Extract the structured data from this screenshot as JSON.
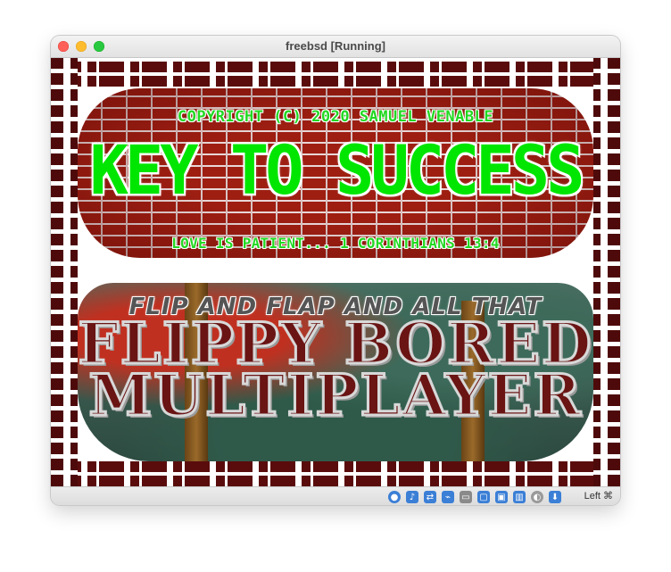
{
  "window": {
    "title": "freebsd [Running]"
  },
  "game": {
    "top_banner": {
      "copyright": "COPYRIGHT (C) 2020 SAMUEL VENABLE",
      "title": "KEY TO SUCCESS",
      "verse": "LOVE IS PATIENT... 1 CORINTHIANS 13:4"
    },
    "bottom_banner": {
      "subtitle": "FLIP AND FLAP AND ALL THAT",
      "title_line1": "FLIPPY BORED",
      "title_line2": "MULTIPLAYER"
    }
  },
  "statusbar": {
    "icons": [
      {
        "name": "optical-disk-icon",
        "color": "#3b7fd6"
      },
      {
        "name": "audio-icon",
        "color": "#3b7fd6"
      },
      {
        "name": "network-icon",
        "color": "#3b7fd6"
      },
      {
        "name": "usb-icon",
        "color": "#3b7fd6"
      },
      {
        "name": "shared-folder-icon",
        "color": "#8a8a8a"
      },
      {
        "name": "display-icon",
        "color": "#3b7fd6"
      },
      {
        "name": "video-capture-icon",
        "color": "#3b7fd6"
      },
      {
        "name": "cpu-icon",
        "color": "#3b7fd6"
      },
      {
        "name": "mouse-integration-icon",
        "color": "#9a9a9a"
      },
      {
        "name": "keyboard-capture-icon",
        "color": "#3b7fd6"
      }
    ],
    "host_key": "Left ⌘"
  },
  "colors": {
    "title_green": "#00e600",
    "brick_red": "#8a1a10",
    "frame_dark": "#4e0a0a"
  }
}
